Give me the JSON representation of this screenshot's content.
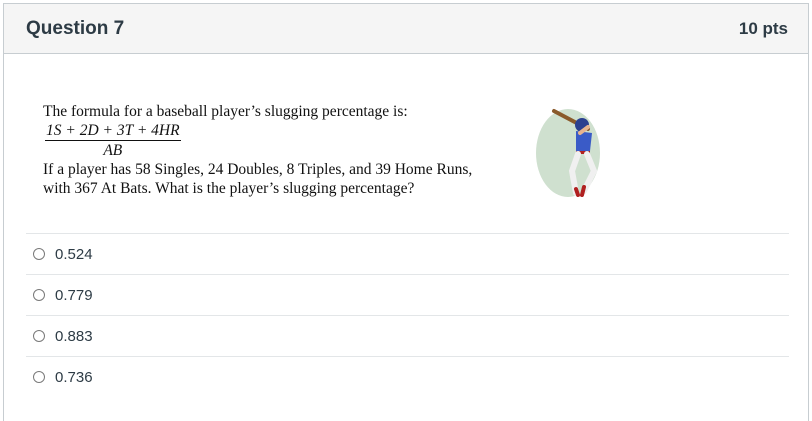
{
  "question": {
    "title": "Question 7",
    "points": "10 pts",
    "stem_line1": "The formula for a baseball player’s slugging percentage is:",
    "formula_numerator": "1S + 2D + 3T + 4HR",
    "formula_denominator": "AB",
    "stem_line2": "If a player has 58 Singles, 24 Doubles, 8 Triples, and 39 Home Runs,",
    "stem_line3": "with 367 At Bats. What is the player’s slugging percentage?",
    "image_icon": "baseball-batter-clipart"
  },
  "answers": [
    {
      "label": "0.524",
      "selected": false
    },
    {
      "label": "0.779",
      "selected": false
    },
    {
      "label": "0.883",
      "selected": false
    },
    {
      "label": "0.736",
      "selected": false
    }
  ]
}
